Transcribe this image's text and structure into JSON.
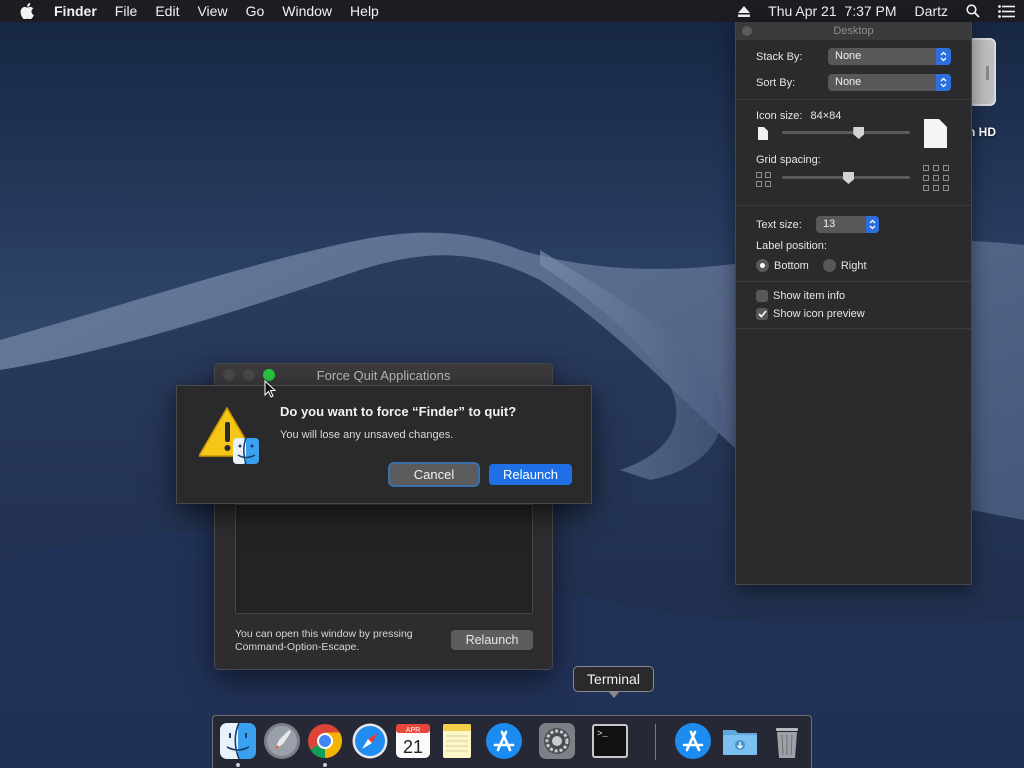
{
  "menubar": {
    "app_name": "Finder",
    "items": [
      "File",
      "Edit",
      "View",
      "Go",
      "Window",
      "Help"
    ],
    "clock": "Thu Apr 21  7:37 PM",
    "user": "Dartz",
    "icons": [
      "apple-icon",
      "eject-icon",
      "spotlight-icon",
      "notification-center-icon"
    ]
  },
  "desktop": {
    "drive_label": "h HD"
  },
  "view_options": {
    "title": "Desktop",
    "stack_by_label": "Stack By:",
    "stack_by_value": "None",
    "sort_by_label": "Sort By:",
    "sort_by_value": "None",
    "icon_size_label": "Icon size:",
    "icon_size_value": "84×84",
    "icon_size_level": 0.6,
    "grid_spacing_label": "Grid spacing:",
    "grid_spacing_level": 0.52,
    "text_size_label": "Text size:",
    "text_size_value": "13",
    "label_position_label": "Label position:",
    "label_position_options": [
      "Bottom",
      "Right"
    ],
    "label_position_selected": "Bottom",
    "show_item_info_label": "Show item info",
    "show_item_info_checked": false,
    "show_icon_preview_label": "Show icon preview",
    "show_icon_preview_checked": true
  },
  "force_quit": {
    "title": "Force Quit Applications",
    "note": "You can open this window by pressing Command-Option-Escape.",
    "relaunch_label": "Relaunch"
  },
  "alert": {
    "title": "Do you want to force “Finder” to quit?",
    "message": "You will lose any unsaved changes.",
    "cancel_label": "Cancel",
    "relaunch_label": "Relaunch"
  },
  "dock": {
    "tooltip": "Terminal",
    "calendar_month": "APR",
    "calendar_day": "21",
    "terminal_prompt": ">_",
    "apps": [
      "Finder",
      "Launchpad",
      "Google Chrome",
      "Safari",
      "Calendar",
      "Notes",
      "App Store",
      "System Preferences",
      "Terminal",
      "App Store",
      "Downloads",
      "Trash"
    ]
  },
  "colors": {
    "accent": "#1f6fe6",
    "close": "#4a4a4c",
    "zoom_active": "#29c940"
  }
}
